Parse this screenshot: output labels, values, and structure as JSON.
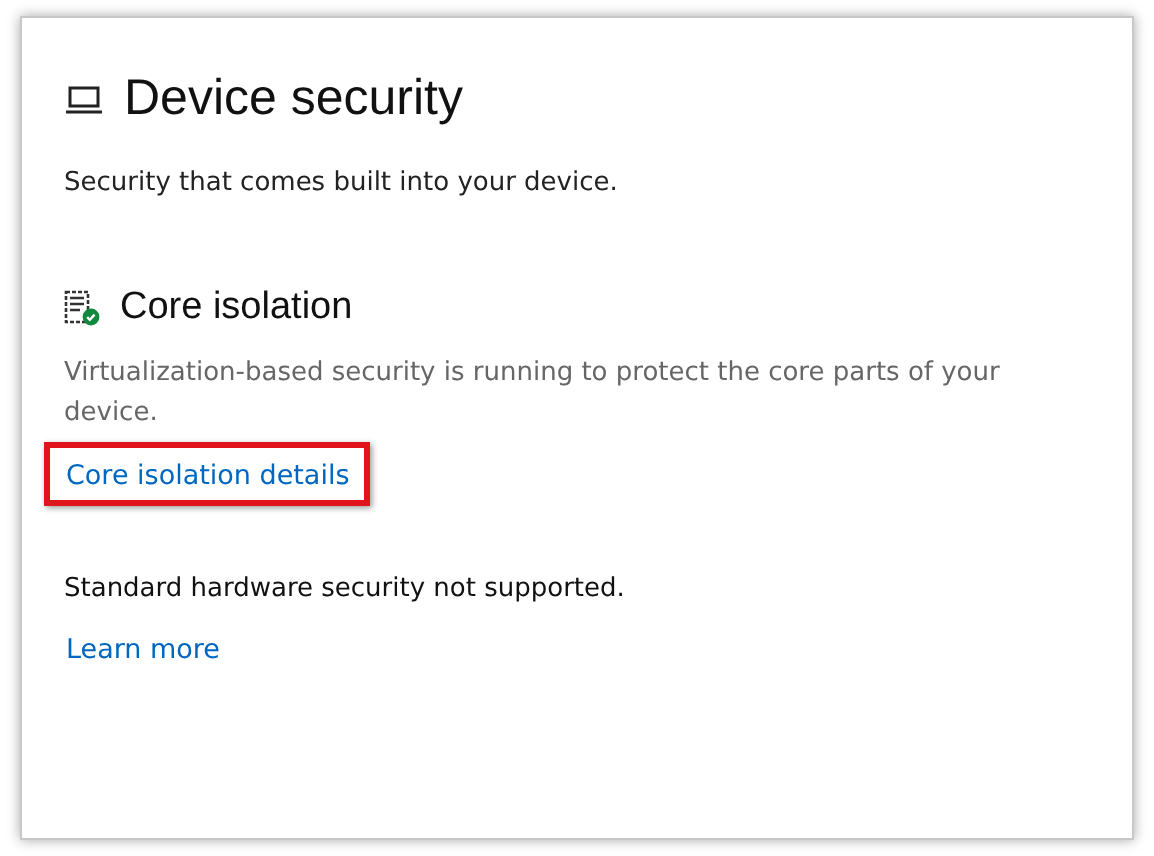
{
  "page": {
    "title": "Device security",
    "subtitle": "Security that comes built into your device."
  },
  "core_isolation": {
    "title": "Core isolation",
    "verified": true,
    "description": "Virtualization-based security is running to protect the core parts of your device.",
    "link": {
      "label": "Core isolation details",
      "highlighted": true
    }
  },
  "hardware": {
    "message": "Standard hardware security not supported.",
    "link": {
      "label": "Learn more",
      "highlighted": false
    }
  }
}
